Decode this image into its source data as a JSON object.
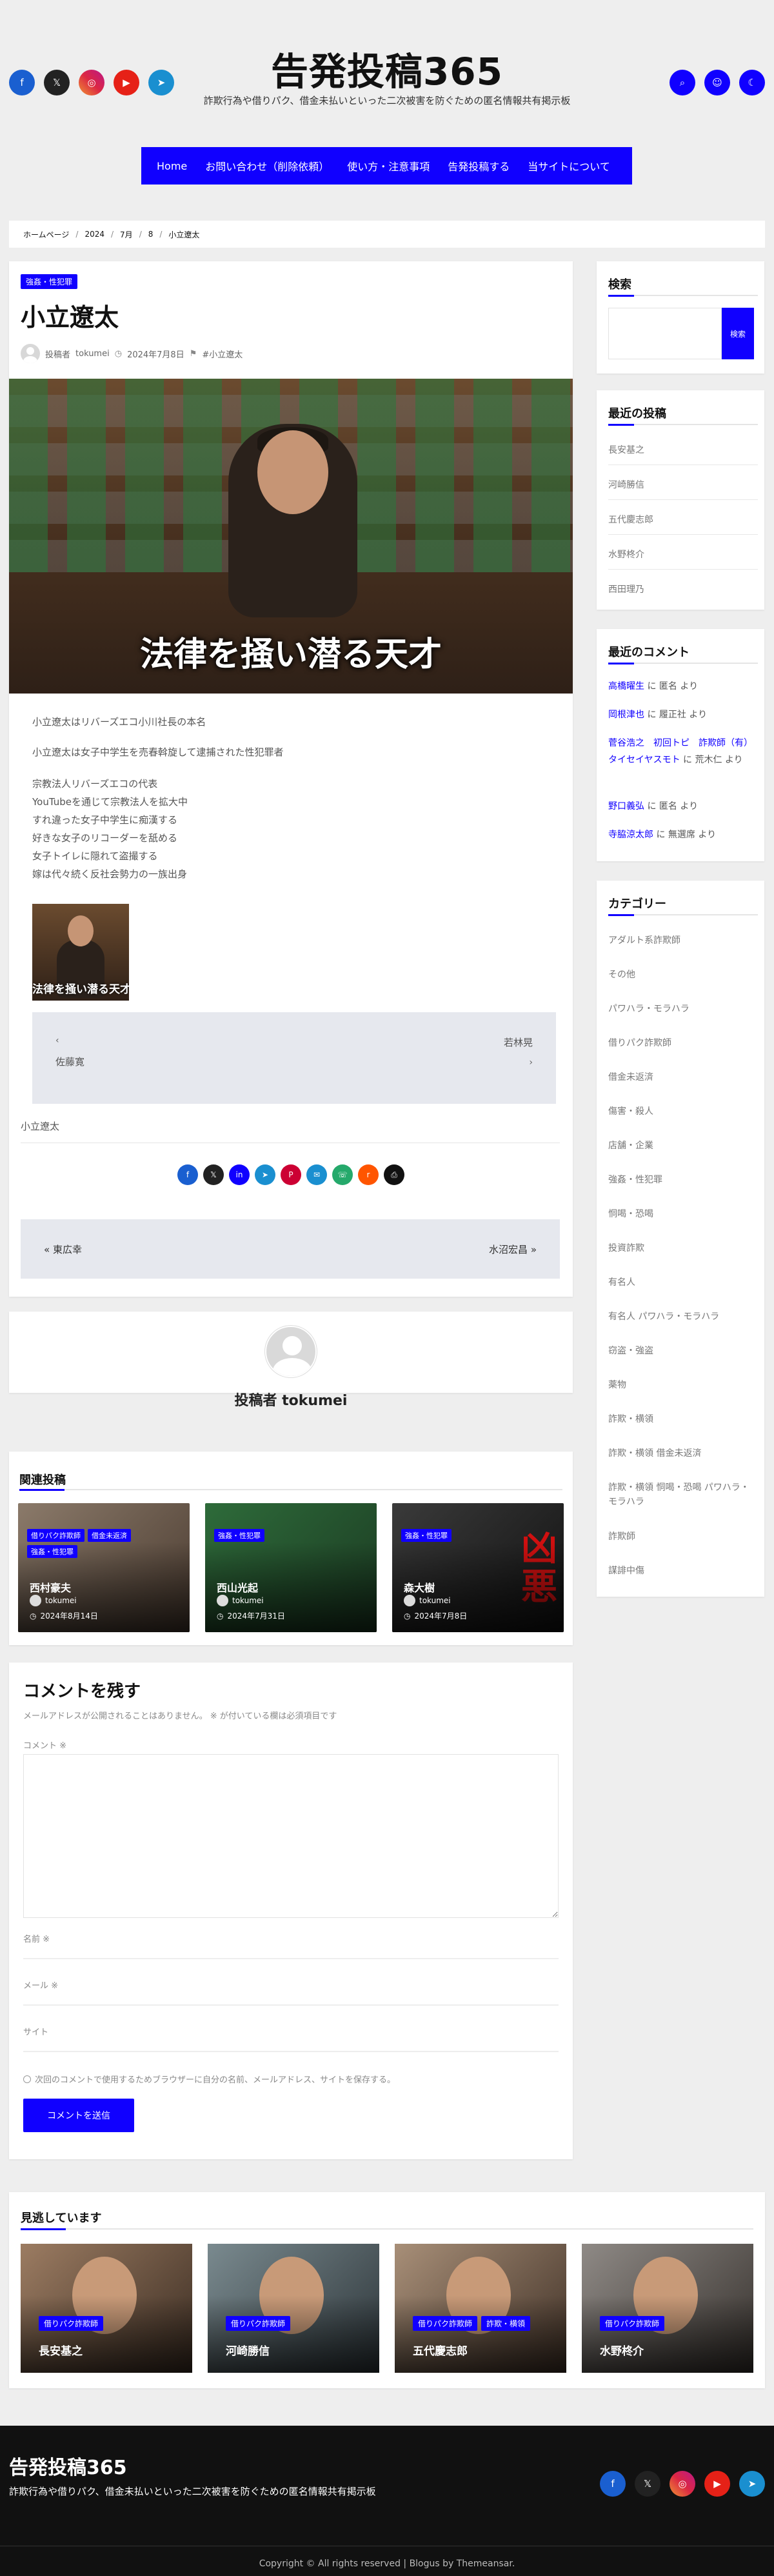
{
  "site": {
    "title": "告発投稿365",
    "tagline": "詐欺行為や借りパク、借金未払いといった二次被害を防ぐための匿名情報共有掲示板"
  },
  "nav": [
    "Home",
    "お問い合わせ（削除依頼）",
    "使い方・注意事項",
    "告発投稿する",
    "当サイトについて"
  ],
  "breadcrumb": [
    "ホームページ",
    "2024",
    "7月",
    "8",
    "小立遼太"
  ],
  "post": {
    "category": "強姦・性犯罪",
    "title": "小立遼太",
    "author_prefix": "投稿者",
    "author": "tokumei",
    "date": "2024年7月8日",
    "tag": "#小立遼太",
    "hero_caption": "法律を掻い潜る天才",
    "paragraphs": [
      "小立遼太はリバーズエコ小川社長の本名",
      "小立遼太は女子中学生を売春斡旋して逮捕された性犯罪者"
    ],
    "list": [
      "宗教法人リバーズエコの代表",
      "YouTubeを通じて宗教法人を拡大中",
      "すれ違った女子中学生に痴漢する",
      "好きな女子のリコーダーを舐める",
      "女子トイレに隠れて盗撮する",
      "嫁は代々続く反社会勢力の一族出身"
    ],
    "thumb_caption": "法律を掻い潜る天才",
    "postnav_prev": "佐藤寛",
    "postnav_next": "若林晃",
    "tag_footer": "小立遼太",
    "prev_post": "東広幸",
    "next_post": "水沼宏昌"
  },
  "author_box": {
    "label": "投稿者 tokumei"
  },
  "related": {
    "heading": "関連投稿",
    "items": [
      {
        "tags": [
          "借りパク詐欺師",
          "借金未返済",
          "強姦・性犯罪"
        ],
        "title": "西村豪夫",
        "author": "tokumei",
        "date": "2024年8月14日"
      },
      {
        "tags": [
          "強姦・性犯罪"
        ],
        "title": "西山光起",
        "author": "tokumei",
        "date": "2024年7月31日"
      },
      {
        "tags": [
          "強姦・性犯罪"
        ],
        "title": "森大樹",
        "author": "tokumei",
        "date": "2024年7月8日"
      }
    ]
  },
  "comment_form": {
    "heading": "コメントを残す",
    "note": "メールアドレスが公開されることはありません。 ※ が付いている欄は必須項目です",
    "comment_label": "コメント ※",
    "name_label": "名前 ※",
    "email_label": "メール ※",
    "site_label": "サイト",
    "remember": "次回のコメントで使用するためブラウザーに自分の名前、メールアドレス、サイトを保存する。",
    "submit": "コメントを送信"
  },
  "sidebar": {
    "search": {
      "title": "検索",
      "button": "検索"
    },
    "recent_posts": {
      "title": "最近の投稿",
      "items": [
        "長安基之",
        "河崎勝信",
        "五代慶志郎",
        "水野柊介",
        "西田理乃"
      ]
    },
    "recent_comments": {
      "title": "最近のコメント",
      "items": [
        {
          "who": "高橋曜生",
          "mid": " に ",
          "what": "匿名",
          "suffix": " より"
        },
        {
          "who": "岡根津也",
          "mid": " に ",
          "what": "履正社",
          "suffix": " より"
        },
        {
          "who": "菅谷浩之　初回トピ　詐欺師（有）タイセイヤスモト",
          "mid": " に ",
          "what": "荒木仁",
          "suffix": " より"
        },
        {
          "who": "野口義弘",
          "mid": " に ",
          "what": "匿名",
          "suffix": " より"
        },
        {
          "who": "寺脇涼太郎",
          "mid": " に ",
          "what": "無選席",
          "suffix": " より"
        }
      ]
    },
    "categories": {
      "title": "カテゴリー",
      "items": [
        "アダルト系詐欺師",
        "その他",
        "パワハラ・モラハラ",
        "借りパク詐欺師",
        "借金未返済",
        "傷害・殺人",
        "店舗・企業",
        "強姦・性犯罪",
        "恫喝・恐喝",
        "投資詐欺",
        "有名人",
        "有名人 パワハラ・モラハラ",
        "窃盗・強盗",
        "薬物",
        "詐欺・横領",
        "詐欺・横領 借金未返済",
        "詐欺・横領 恫喝・恐喝 パワハラ・モラハラ",
        "詐欺師",
        "謀誹中傷"
      ]
    }
  },
  "watched": {
    "heading": "見逃しています",
    "items": [
      {
        "tags": [
          "借りパク詐欺師"
        ],
        "title": "長安基之"
      },
      {
        "tags": [
          "借りパク詐欺師"
        ],
        "title": "河崎勝信"
      },
      {
        "tags": [
          "借りパク詐欺師",
          "詐欺・横領"
        ],
        "title": "五代慶志郎"
      },
      {
        "tags": [
          "借りパク詐欺師"
        ],
        "title": "水野柊介"
      }
    ]
  },
  "footer": {
    "title": "告発投稿365",
    "tagline": "詐欺行為や借りパク、借金未払いといった二次被害を防ぐための匿名情報共有掲示板",
    "copyright": "Copyright © All rights reserved | Blogus by Themeansar."
  },
  "colors": {
    "accent": "#1000ff",
    "background": "#eeeeee",
    "footer": "#111111"
  }
}
